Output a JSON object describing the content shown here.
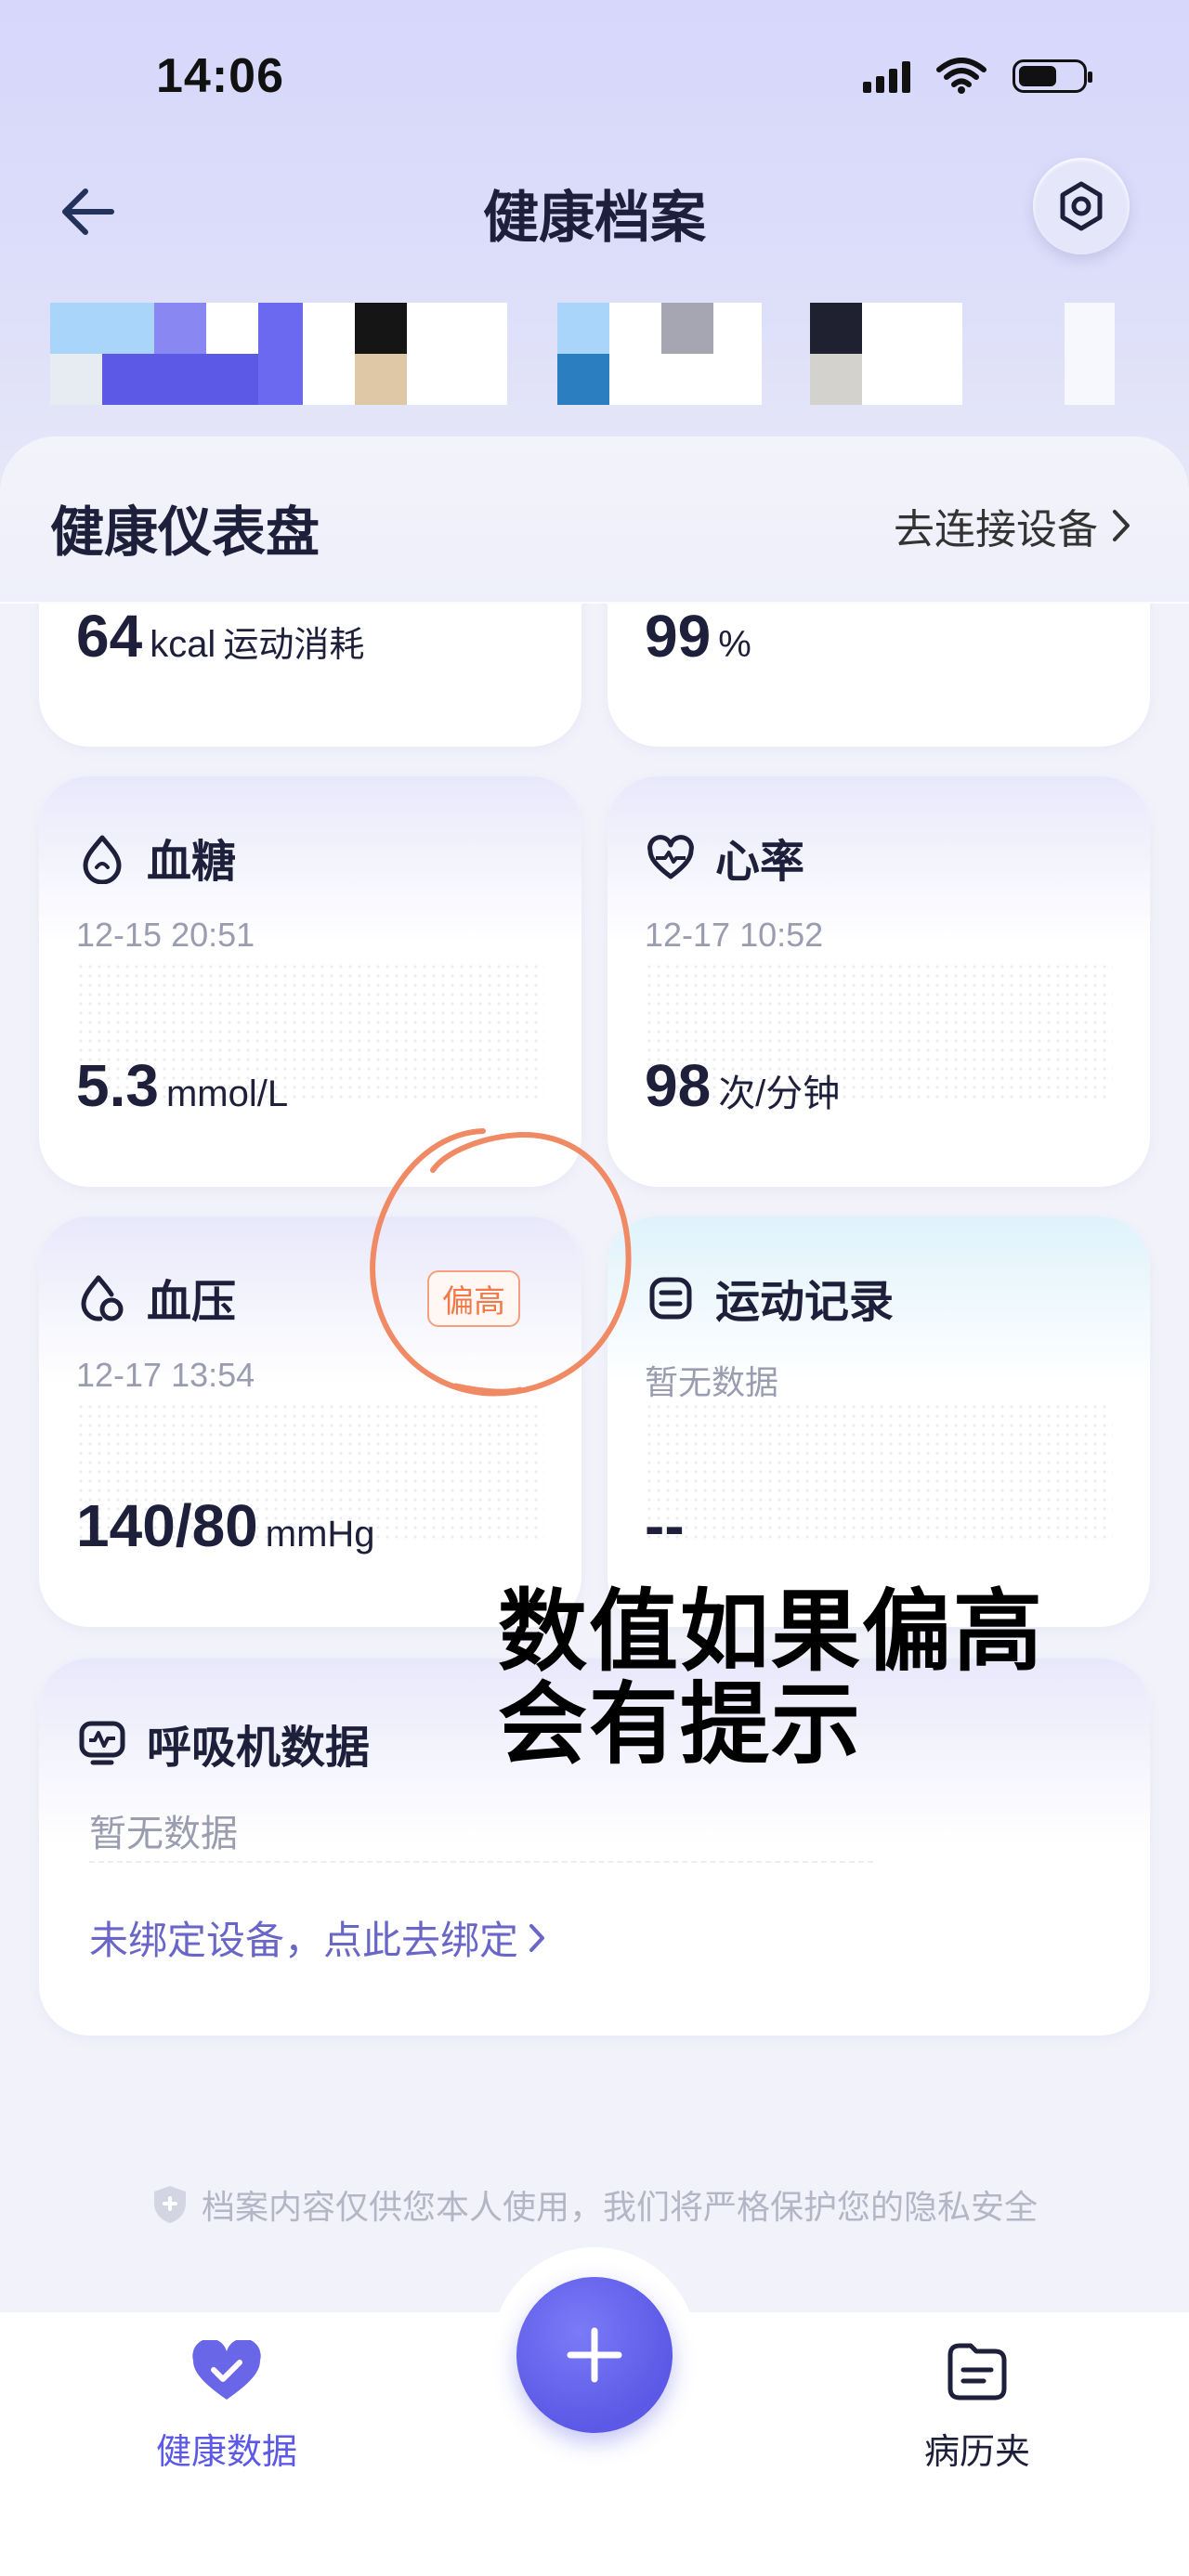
{
  "status_bar": {
    "time": "14:06"
  },
  "nav": {
    "title": "健康档案"
  },
  "dashboard": {
    "title": "健康仪表盘",
    "connect_link": "去连接设备"
  },
  "partial_cards": {
    "calories": {
      "value": "64",
      "unit": "kcal",
      "label": "运动消耗"
    },
    "oxygen": {
      "value": "99",
      "unit": "%"
    }
  },
  "cards": {
    "blood_sugar": {
      "title": "血糖",
      "time": "12-15 20:51",
      "value": "5.3",
      "unit": "mmol/L"
    },
    "heart_rate": {
      "title": "心率",
      "time": "12-17 10:52",
      "value": "98",
      "unit": "次/分钟"
    },
    "blood_pressure": {
      "title": "血压",
      "badge": "偏高",
      "time": "12-17 13:54",
      "value": "140/80",
      "unit": "mmHg"
    },
    "exercise": {
      "title": "运动记录",
      "time": "暂无数据",
      "value": "--"
    },
    "ventilator": {
      "title": "呼吸机数据",
      "no_data": "暂无数据",
      "bind_link": "未绑定设备，点此去绑定"
    }
  },
  "annotation": {
    "line1": "数值如果偏高",
    "line2": "会有提示"
  },
  "privacy_note": "档案内容仅供您本人使用，我们将严格保护您的隐私安全",
  "tabbar": {
    "health_data": "健康数据",
    "records": "病历夹",
    "active_color": "#5b59e6"
  }
}
